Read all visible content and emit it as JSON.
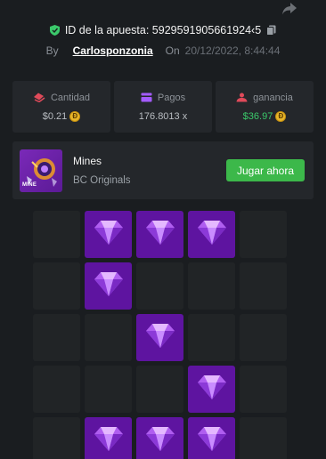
{
  "header": {
    "bet_id": "ID de la apuesta: 5929591905661924‹5",
    "by_label": "By",
    "username": "Carlosponzonia",
    "on_label": "On",
    "date": "20/12/2022, 8:44:44"
  },
  "stats": [
    {
      "label": "Cantidad",
      "value": "$0.21",
      "icon": "amount-icon"
    },
    {
      "label": "Pagos",
      "value": "176.8013 x",
      "icon": "payout-icon"
    },
    {
      "label": "ganancia",
      "value": "$36.97",
      "icon": "profit-icon"
    }
  ],
  "game": {
    "name": "Mines",
    "provider": "BC Originals",
    "thumb_label": "MINE",
    "play_label": "Jugar ahora"
  },
  "board": {
    "rows": 5,
    "cols": 5,
    "cells": [
      0,
      1,
      1,
      1,
      0,
      0,
      1,
      0,
      0,
      0,
      0,
      0,
      1,
      0,
      0,
      0,
      0,
      0,
      1,
      0,
      0,
      1,
      1,
      1,
      0
    ]
  },
  "colors": {
    "background": "#1a1d20",
    "panel": "#24272b",
    "gem_tile": "#5e14a0",
    "win_green": "#3bc96b",
    "button_green": "#3cb84a"
  }
}
